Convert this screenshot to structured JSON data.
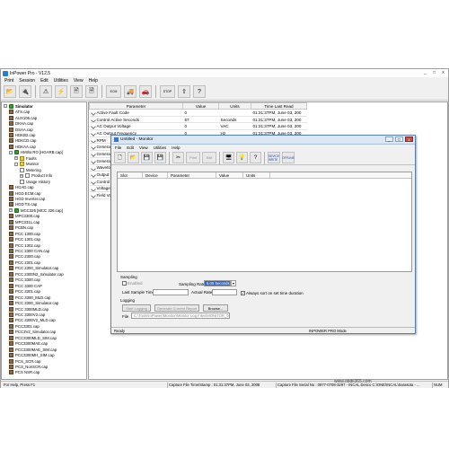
{
  "app": {
    "title": "InPower Pro - V12.5",
    "menu": [
      "Print",
      "Session",
      "Edit",
      "Utilities",
      "View",
      "Help"
    ],
    "window_controls": [
      "_",
      "□",
      "x"
    ]
  },
  "toolbar": {
    "buttons": [
      {
        "name": "open-file-button",
        "glyph": "📂"
      },
      {
        "name": "connect-button",
        "glyph": "🔌"
      },
      {
        "name": "warning-button",
        "glyph": "⚠"
      },
      {
        "name": "fault-button",
        "glyph": "⚡"
      },
      {
        "name": "calibrate-button",
        "glyph": "🖹"
      },
      {
        "name": "monitor-button",
        "glyph": "🗎"
      },
      {
        "name": "ecm-button",
        "glyph": "ECM"
      },
      {
        "name": "truck-button",
        "glyph": "🚚"
      },
      {
        "name": "car-button",
        "glyph": "🚗"
      },
      {
        "name": "stop-button",
        "glyph": "STOP"
      },
      {
        "name": "upload-button",
        "glyph": "⇧"
      },
      {
        "name": "help-button",
        "glyph": "?"
      }
    ]
  },
  "tree": {
    "items": [
      {
        "label": "Simulator",
        "indent": 0,
        "type": "root",
        "exp": "-",
        "bold": true
      },
      {
        "label": "ATS.cap",
        "indent": 1,
        "type": "file"
      },
      {
        "label": "AUX105.cap",
        "indent": 1,
        "type": "file"
      },
      {
        "label": "DKHA.cap",
        "indent": 1,
        "type": "file"
      },
      {
        "label": "DSAA.cap",
        "indent": 1,
        "type": "file"
      },
      {
        "label": "HDKB2.cap",
        "indent": 1,
        "type": "file"
      },
      {
        "label": "HDKCD.cap",
        "indent": 1,
        "type": "file"
      },
      {
        "label": "HDKAA.cap",
        "indent": 1,
        "type": "file"
      },
      {
        "label": "HMIlsr.RO [HGARB.cap]",
        "indent": 1,
        "type": "root",
        "exp": "-"
      },
      {
        "label": "Faults",
        "indent": 2,
        "type": "folder",
        "exp": "+"
      },
      {
        "label": "Monitor",
        "indent": 2,
        "type": "folder",
        "exp": "-"
      },
      {
        "label": "Metering",
        "indent": 3,
        "type": "page"
      },
      {
        "label": "Product Info",
        "indent": 3,
        "type": "page",
        "exp": "+"
      },
      {
        "label": "Usage History",
        "indent": 3,
        "type": "page"
      },
      {
        "label": "HGAD.cap",
        "indent": 1,
        "type": "file"
      },
      {
        "label": "HGD ECM.cap",
        "indent": 1,
        "type": "file"
      },
      {
        "label": "HGD Inverter.cap",
        "indent": 1,
        "type": "file"
      },
      {
        "label": "HGD TS.cap",
        "indent": 1,
        "type": "file"
      },
      {
        "label": "MCC326 [MCC 326.cap]",
        "indent": 1,
        "type": "root",
        "exp": "+"
      },
      {
        "label": "MPC3300.cap",
        "indent": 1,
        "type": "file"
      },
      {
        "label": "MPC331L.cap",
        "indent": 1,
        "type": "file"
      },
      {
        "label": "PCBN.cap",
        "indent": 1,
        "type": "file"
      },
      {
        "label": "PCC 1300.cap",
        "indent": 1,
        "type": "file"
      },
      {
        "label": "PCC 1301.cap",
        "indent": 1,
        "type": "file"
      },
      {
        "label": "PCC 1302.cap",
        "indent": 1,
        "type": "file"
      },
      {
        "label": "PCC 2300 CAN.cap",
        "indent": 1,
        "type": "file"
      },
      {
        "label": "PCC 2300.cap",
        "indent": 1,
        "type": "file"
      },
      {
        "label": "PCC 2301.cap",
        "indent": 1,
        "type": "file"
      },
      {
        "label": "PCC 2300_Simulator.cap",
        "indent": 1,
        "type": "file"
      },
      {
        "label": "PCC 2300N2_Simulator.cap",
        "indent": 1,
        "type": "file"
      },
      {
        "label": "PCC 3300.cap",
        "indent": 1,
        "type": "file"
      },
      {
        "label": "PCC 3300 CAP",
        "indent": 1,
        "type": "file"
      },
      {
        "label": "PCC 3301.cap",
        "indent": 1,
        "type": "file"
      },
      {
        "label": "PCC 3300_MLD.cap",
        "indent": 1,
        "type": "file"
      },
      {
        "label": "PCC 3300_Simulator.cap",
        "indent": 1,
        "type": "file"
      },
      {
        "label": "PCC 3300MLD.cap",
        "indent": 1,
        "type": "file"
      },
      {
        "label": "PCC 3300V2.cap",
        "indent": 1,
        "type": "file"
      },
      {
        "label": "PCC 3300V2_MLD.cap",
        "indent": 1,
        "type": "file"
      },
      {
        "label": "PCC3301.cap",
        "indent": 1,
        "type": "file"
      },
      {
        "label": "PCC3V2_Simulator.cap",
        "indent": 1,
        "type": "file"
      },
      {
        "label": "PCC3300MLD_SIM.cap",
        "indent": 1,
        "type": "file"
      },
      {
        "label": "PCC3300MAE.cap",
        "indent": 1,
        "type": "file"
      },
      {
        "label": "PCC3300MAE_SIM.cap",
        "indent": 1,
        "type": "file"
      },
      {
        "label": "PCC3300MH_SIM.cap",
        "indent": 1,
        "type": "file"
      },
      {
        "label": "PCS_SCR.cap",
        "indent": 1,
        "type": "file"
      },
      {
        "label": "PCS_NonSCR.cap",
        "indent": 1,
        "type": "file"
      },
      {
        "label": "PCS NSR.cap",
        "indent": 1,
        "type": "file"
      }
    ]
  },
  "params": {
    "columns": [
      "Parameter",
      "Value",
      "Units",
      "Time Last Read"
    ],
    "rows": [
      {
        "name": "Active Fault Code",
        "value": "0",
        "units": "",
        "time": "01:31:37PM, June 03, 200"
      },
      {
        "name": "Control Active Seconds",
        "value": "67",
        "units": "Seconds",
        "time": "01:31:37PM, June 03, 200"
      },
      {
        "name": "AC Output Voltage",
        "value": "0",
        "units": "VAC",
        "time": "01:31:37PM, June 03, 200"
      },
      {
        "name": "AC Output Frequency",
        "value": "0",
        "units": "Hz",
        "time": "01:31:37PM, June 03, 200"
      },
      {
        "name": "RPM",
        "value": "",
        "units": "",
        "time": ""
      },
      {
        "name": "Generat",
        "value": "",
        "units": "",
        "time": ""
      },
      {
        "name": "Generat",
        "value": "",
        "units": "",
        "time": ""
      },
      {
        "name": "Generat",
        "value": "",
        "units": "",
        "time": ""
      },
      {
        "name": "Waveto",
        "value": "",
        "units": "",
        "time": ""
      },
      {
        "name": "Output V",
        "value": "",
        "units": "",
        "time": ""
      },
      {
        "name": "Control",
        "value": "",
        "units": "",
        "time": ""
      },
      {
        "name": "Voltage",
        "value": "",
        "units": "",
        "time": ""
      },
      {
        "name": "Field Vo",
        "value": "",
        "units": "",
        "time": ""
      }
    ]
  },
  "statusbar": {
    "help": "For Help, Press F1",
    "capture_time": "Capture File Time/Stamp : 01:31:37PM, June 03, 2008",
    "capture_serial": "Capture File Serial No : 0977-0708-3297 - INCAL Desco C:\\ONE\\INCAL\\Sarasota - ...",
    "num": "NUM"
  },
  "monitor": {
    "title": "Untitled - Monitor",
    "menu": [
      "File",
      "Edit",
      "View",
      "Utilities",
      "Help"
    ],
    "toolbar": [
      {
        "name": "new-icon",
        "glyph": "🗋",
        "kind": "icon"
      },
      {
        "name": "open-icon",
        "glyph": "📂",
        "kind": "icon"
      },
      {
        "name": "save-icon",
        "glyph": "💾",
        "kind": "icon"
      },
      {
        "name": "save-all-icon",
        "glyph": "💾",
        "kind": "icon"
      },
      {
        "name": "cut-icon",
        "glyph": "✂",
        "kind": "icon"
      },
      {
        "name": "print-button",
        "glyph": "Print",
        "kind": "txt"
      },
      {
        "name": "edit-button",
        "glyph": "Edit",
        "kind": "txt"
      },
      {
        "name": "monitor-icon",
        "glyph": "🖥",
        "kind": "icon"
      },
      {
        "name": "info-icon",
        "glyph": "💡",
        "kind": "icon"
      },
      {
        "name": "help-icon",
        "glyph": "?",
        "kind": "icon"
      },
      {
        "name": "device-button",
        "glyph": "DEVICE WRITE",
        "kind": "blue"
      },
      {
        "name": "offline-button",
        "glyph": "OFFLINE",
        "kind": "blue"
      }
    ],
    "grid_columns": [
      "Slot",
      "Device",
      "Parameter",
      "Value",
      "Units"
    ],
    "sampling": {
      "group_label": "Sampling",
      "enabled_label": "Enabled",
      "rate_label": "Sampling Rate",
      "rate_value": "5.00 Seconds",
      "last_time_label": "Last Sample Time",
      "actual_rate_label": "Actual Rate",
      "always_on_label": "Always sort on set time duration"
    },
    "logging": {
      "group_label": "Logging",
      "start_label": "Start Logging",
      "generate_label": "Generate Current Report",
      "browse_label": "Browse...",
      "file_label": "File",
      "file_value": "C:\\Tools\\InPower\\Monitor\\Monitor Log Files\\MONITOR_06..."
    },
    "status_left": "Ready",
    "status_right": "INPOWER PRO Mode"
  },
  "watermark": "www.obdii365.com"
}
